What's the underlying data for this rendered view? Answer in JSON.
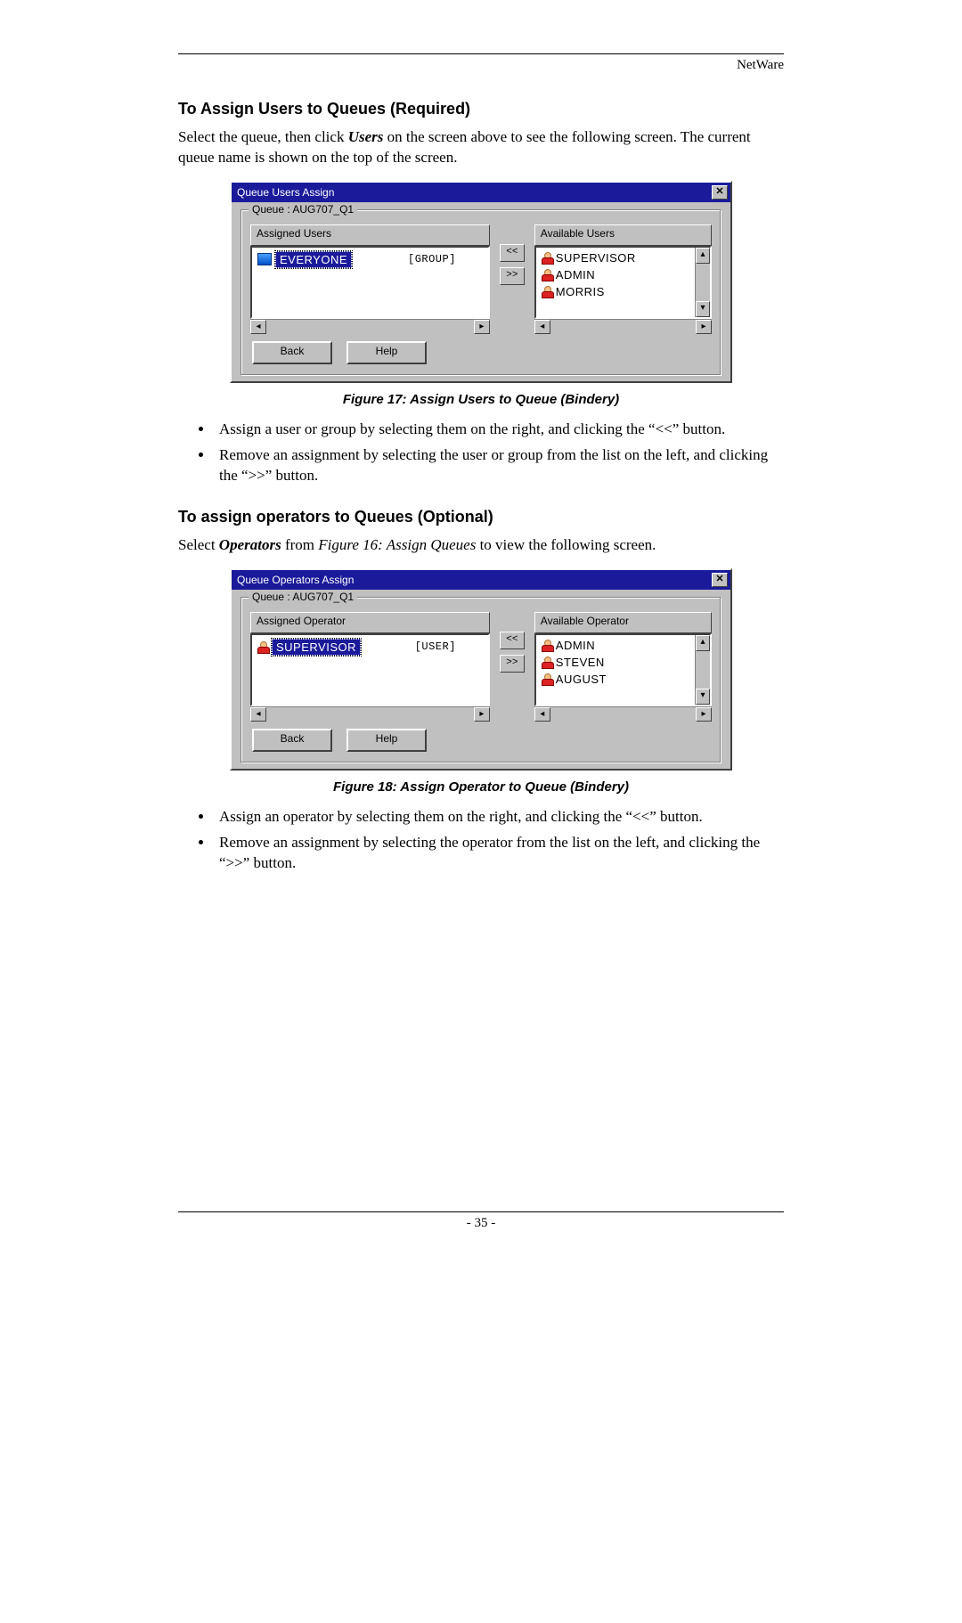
{
  "header": {
    "label": "NetWare"
  },
  "section1": {
    "title": "To Assign Users to Queues (Required)",
    "intro_pre": "Select the queue, then click ",
    "intro_bold": "Users",
    "intro_post": " on the screen above to see the following screen. The current queue name is shown on the top of the screen.",
    "caption": "Figure 17: Assign Users to Queue (Bindery)",
    "bullets": [
      "Assign a user or group by selecting them on the right, and clicking the “<<” button.",
      "Remove an assignment by selecting the user or group from the list on the left, and clicking the “>>” button."
    ]
  },
  "dialog1": {
    "title": "Queue Users Assign",
    "close": "✕",
    "legend": "Queue : AUG707_Q1",
    "header_left": "Assigned Users",
    "header_right": "Available Users",
    "arrow_left": "<<",
    "arrow_right": ">>",
    "assigned": [
      {
        "name": "EVERYONE",
        "type": "[GROUP]",
        "icon": "group",
        "selected": true
      }
    ],
    "available": [
      {
        "name": "SUPERVISOR",
        "icon": "user"
      },
      {
        "name": "ADMIN",
        "icon": "user"
      },
      {
        "name": "MORRIS",
        "icon": "user"
      }
    ],
    "back": "Back",
    "help": "Help"
  },
  "section2": {
    "title": "To assign operators to Queues (Optional)",
    "intro_pre": "Select ",
    "intro_bold": "Operators",
    "intro_mid": " from ",
    "intro_italic": "Figure 16: Assign Queues",
    "intro_post": " to view the following screen.",
    "caption": "Figure 18: Assign Operator to Queue (Bindery)",
    "bullets": [
      "Assign an operator by selecting them on the right, and clicking the “<<” button.",
      "Remove an assignment by selecting the operator from the list on the left, and clicking the “>>” button."
    ]
  },
  "dialog2": {
    "title": "Queue Operators Assign",
    "close": "✕",
    "legend": "Queue : AUG707_Q1",
    "header_left": "Assigned Operator",
    "header_right": "Available Operator",
    "arrow_left": "<<",
    "arrow_right": ">>",
    "assigned": [
      {
        "name": "SUPERVISOR",
        "type": "[USER]",
        "icon": "user",
        "selected": true
      }
    ],
    "available": [
      {
        "name": "ADMIN",
        "icon": "user"
      },
      {
        "name": "STEVEN",
        "icon": "user"
      },
      {
        "name": "AUGUST",
        "icon": "user"
      }
    ],
    "back": "Back",
    "help": "Help"
  },
  "footer": {
    "page": "- 35 -"
  }
}
